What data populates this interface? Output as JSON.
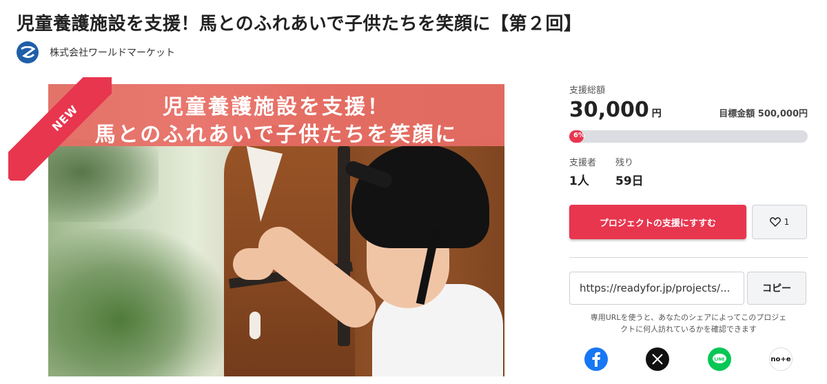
{
  "page": {
    "title": "児童養護施設を支援！馬とのふれあいで子供たちを笑顔に【第２回】"
  },
  "owner": {
    "name": "株式会社ワールドマーケット"
  },
  "hero": {
    "ribbon": "NEW",
    "banner_line1": "児童養護施設を支援！",
    "banner_line2": "馬とのふれあいで子供たちを笑顔に"
  },
  "funding": {
    "total_label": "支援総額",
    "total_amount": "30,000",
    "total_unit": "円",
    "goal_text": "目標金額 500,000円",
    "progress_fraction": 0.06,
    "progress_label": "6%",
    "supporters_label": "支援者",
    "supporters_value": "1人",
    "remaining_label": "残り",
    "remaining_value": "59日"
  },
  "actions": {
    "support_label": "プロジェクトの支援にすすむ",
    "favorite_count": "1"
  },
  "share": {
    "url": "https://readyfor.jp/projects/...",
    "copy_label": "コピー",
    "note_line1": "専用URLを使うと、あなたのシェアによってこのプロジェ",
    "note_line2": "クトに何人訪れているかを確認できます",
    "note_icon_text": "no+e"
  },
  "colors": {
    "accent": "#e8364f",
    "banner": "#e86d65",
    "facebook": "#1877f2",
    "x": "#111111",
    "line": "#06c755"
  },
  "icons": [
    "owner-logo-icon",
    "heart-icon",
    "facebook-icon",
    "x-icon",
    "line-icon",
    "note-icon"
  ]
}
